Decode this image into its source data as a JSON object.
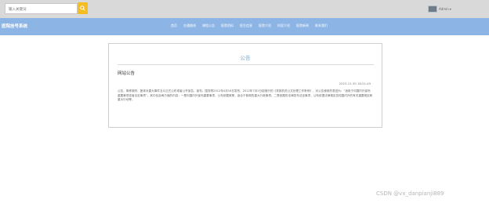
{
  "search": {
    "placeholder": "输入关键词"
  },
  "user": {
    "name": "Admin"
  },
  "navbar": {
    "brand": "医院挂号系统",
    "items": [
      "首页",
      "交通路线",
      "课程公告",
      "医院资料",
      "医生信息",
      "医院介绍",
      "科室介绍",
      "医院新闻",
      "联系我们"
    ]
  },
  "notice": {
    "section_title": "公告",
    "heading": "网站公告",
    "date": "2023-11-30 18:21:49",
    "body": "公告，简称政府、团体对重大事件当众正式公布或者公开宣告，宣布。国务院2012年4月16日发布、2012年7月1日起施行的《党政机关公文处理工作条例》，对公告使用的表述为：“适用于向国内外宣布重要事项或者法定事项”。其中包含两方面的内容：一是向国内外宣布重要事项，公布依据政策，适合于新闻的重大行政事项；二是依据的法律发布法定事项，公布依据法律规定告知国内外的有关重要规定和重大行动等。"
  },
  "watermark": "CSDN @vx_danpianji889",
  "colors": {
    "topbar": "#d9d9d9",
    "navbar": "#8cb5e6",
    "search_button": "#f5bd1f",
    "title": "#7ba9c7"
  }
}
